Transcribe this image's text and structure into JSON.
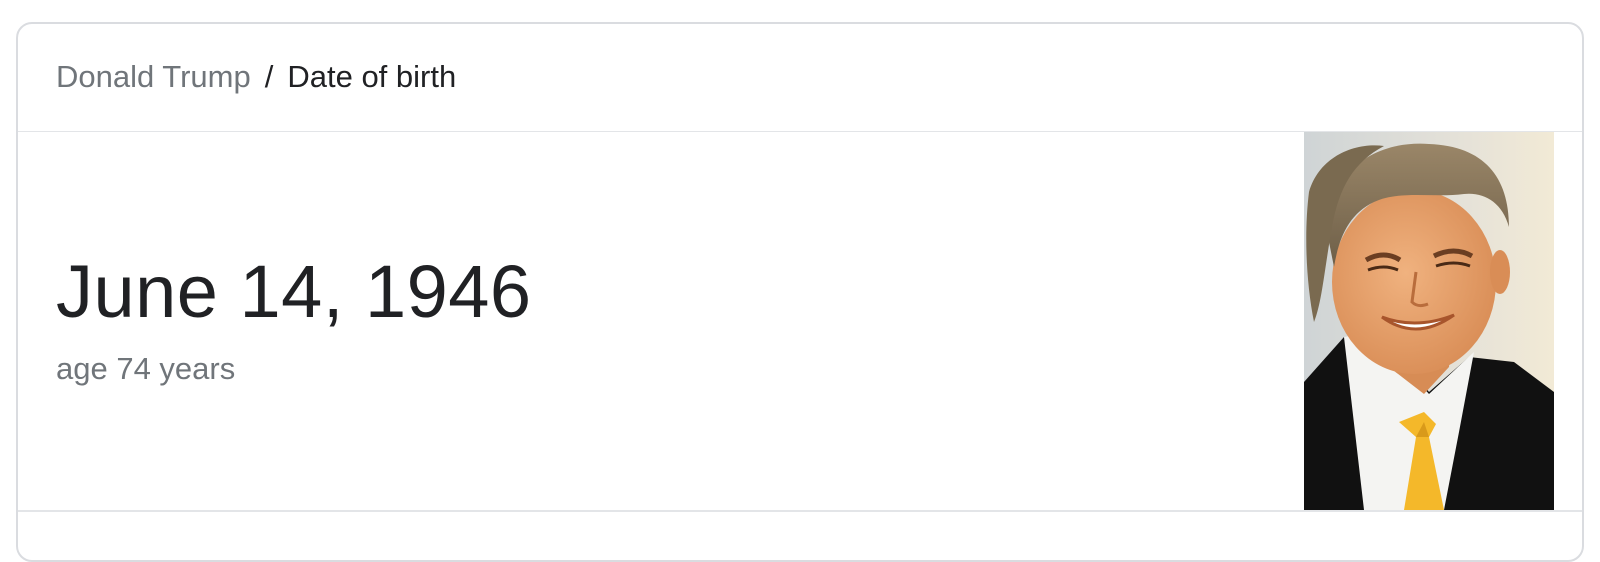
{
  "breadcrumb": {
    "entity": "Donald Trump",
    "separator": "/",
    "attribute": "Date of birth"
  },
  "answer": {
    "date": "June 14, 1946",
    "age": "age 74 years"
  },
  "photo": {
    "subject": "portrait-photo"
  },
  "colors": {
    "primary_text": "#202124",
    "secondary_text": "#70757a",
    "border": "#dadce0",
    "tie": "#f4b82a",
    "suit": "#111111"
  }
}
